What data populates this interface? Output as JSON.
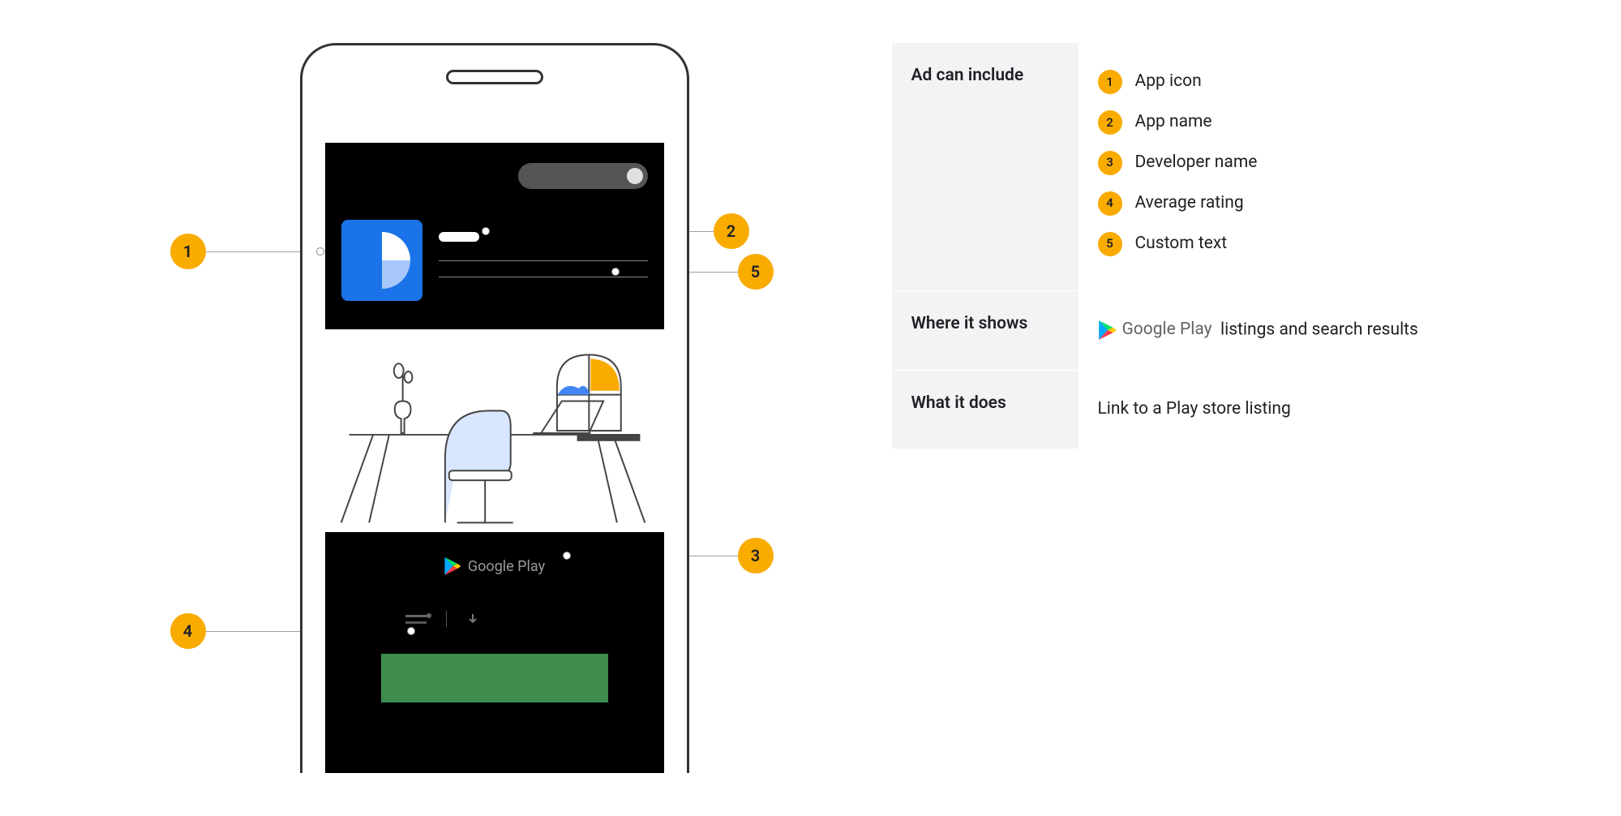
{
  "info": {
    "canInclude": {
      "label": "Ad can include",
      "items": [
        {
          "num": "1",
          "text": "App icon"
        },
        {
          "num": "2",
          "text": "App name"
        },
        {
          "num": "3",
          "text": "Developer name"
        },
        {
          "num": "4",
          "text": "Average rating"
        },
        {
          "num": "5",
          "text": "Custom text"
        }
      ]
    },
    "whereShows": {
      "label": "Where it shows",
      "brand": "Google Play",
      "suffix": "listings and search results"
    },
    "whatItDoes": {
      "label": "What it does",
      "text": "Link to a Play store listing"
    }
  },
  "phone": {
    "googlePlayLabel": "Google Play"
  },
  "callouts": {
    "b1": "1",
    "b2": "2",
    "b3": "3",
    "b4": "4",
    "b5": "5"
  }
}
